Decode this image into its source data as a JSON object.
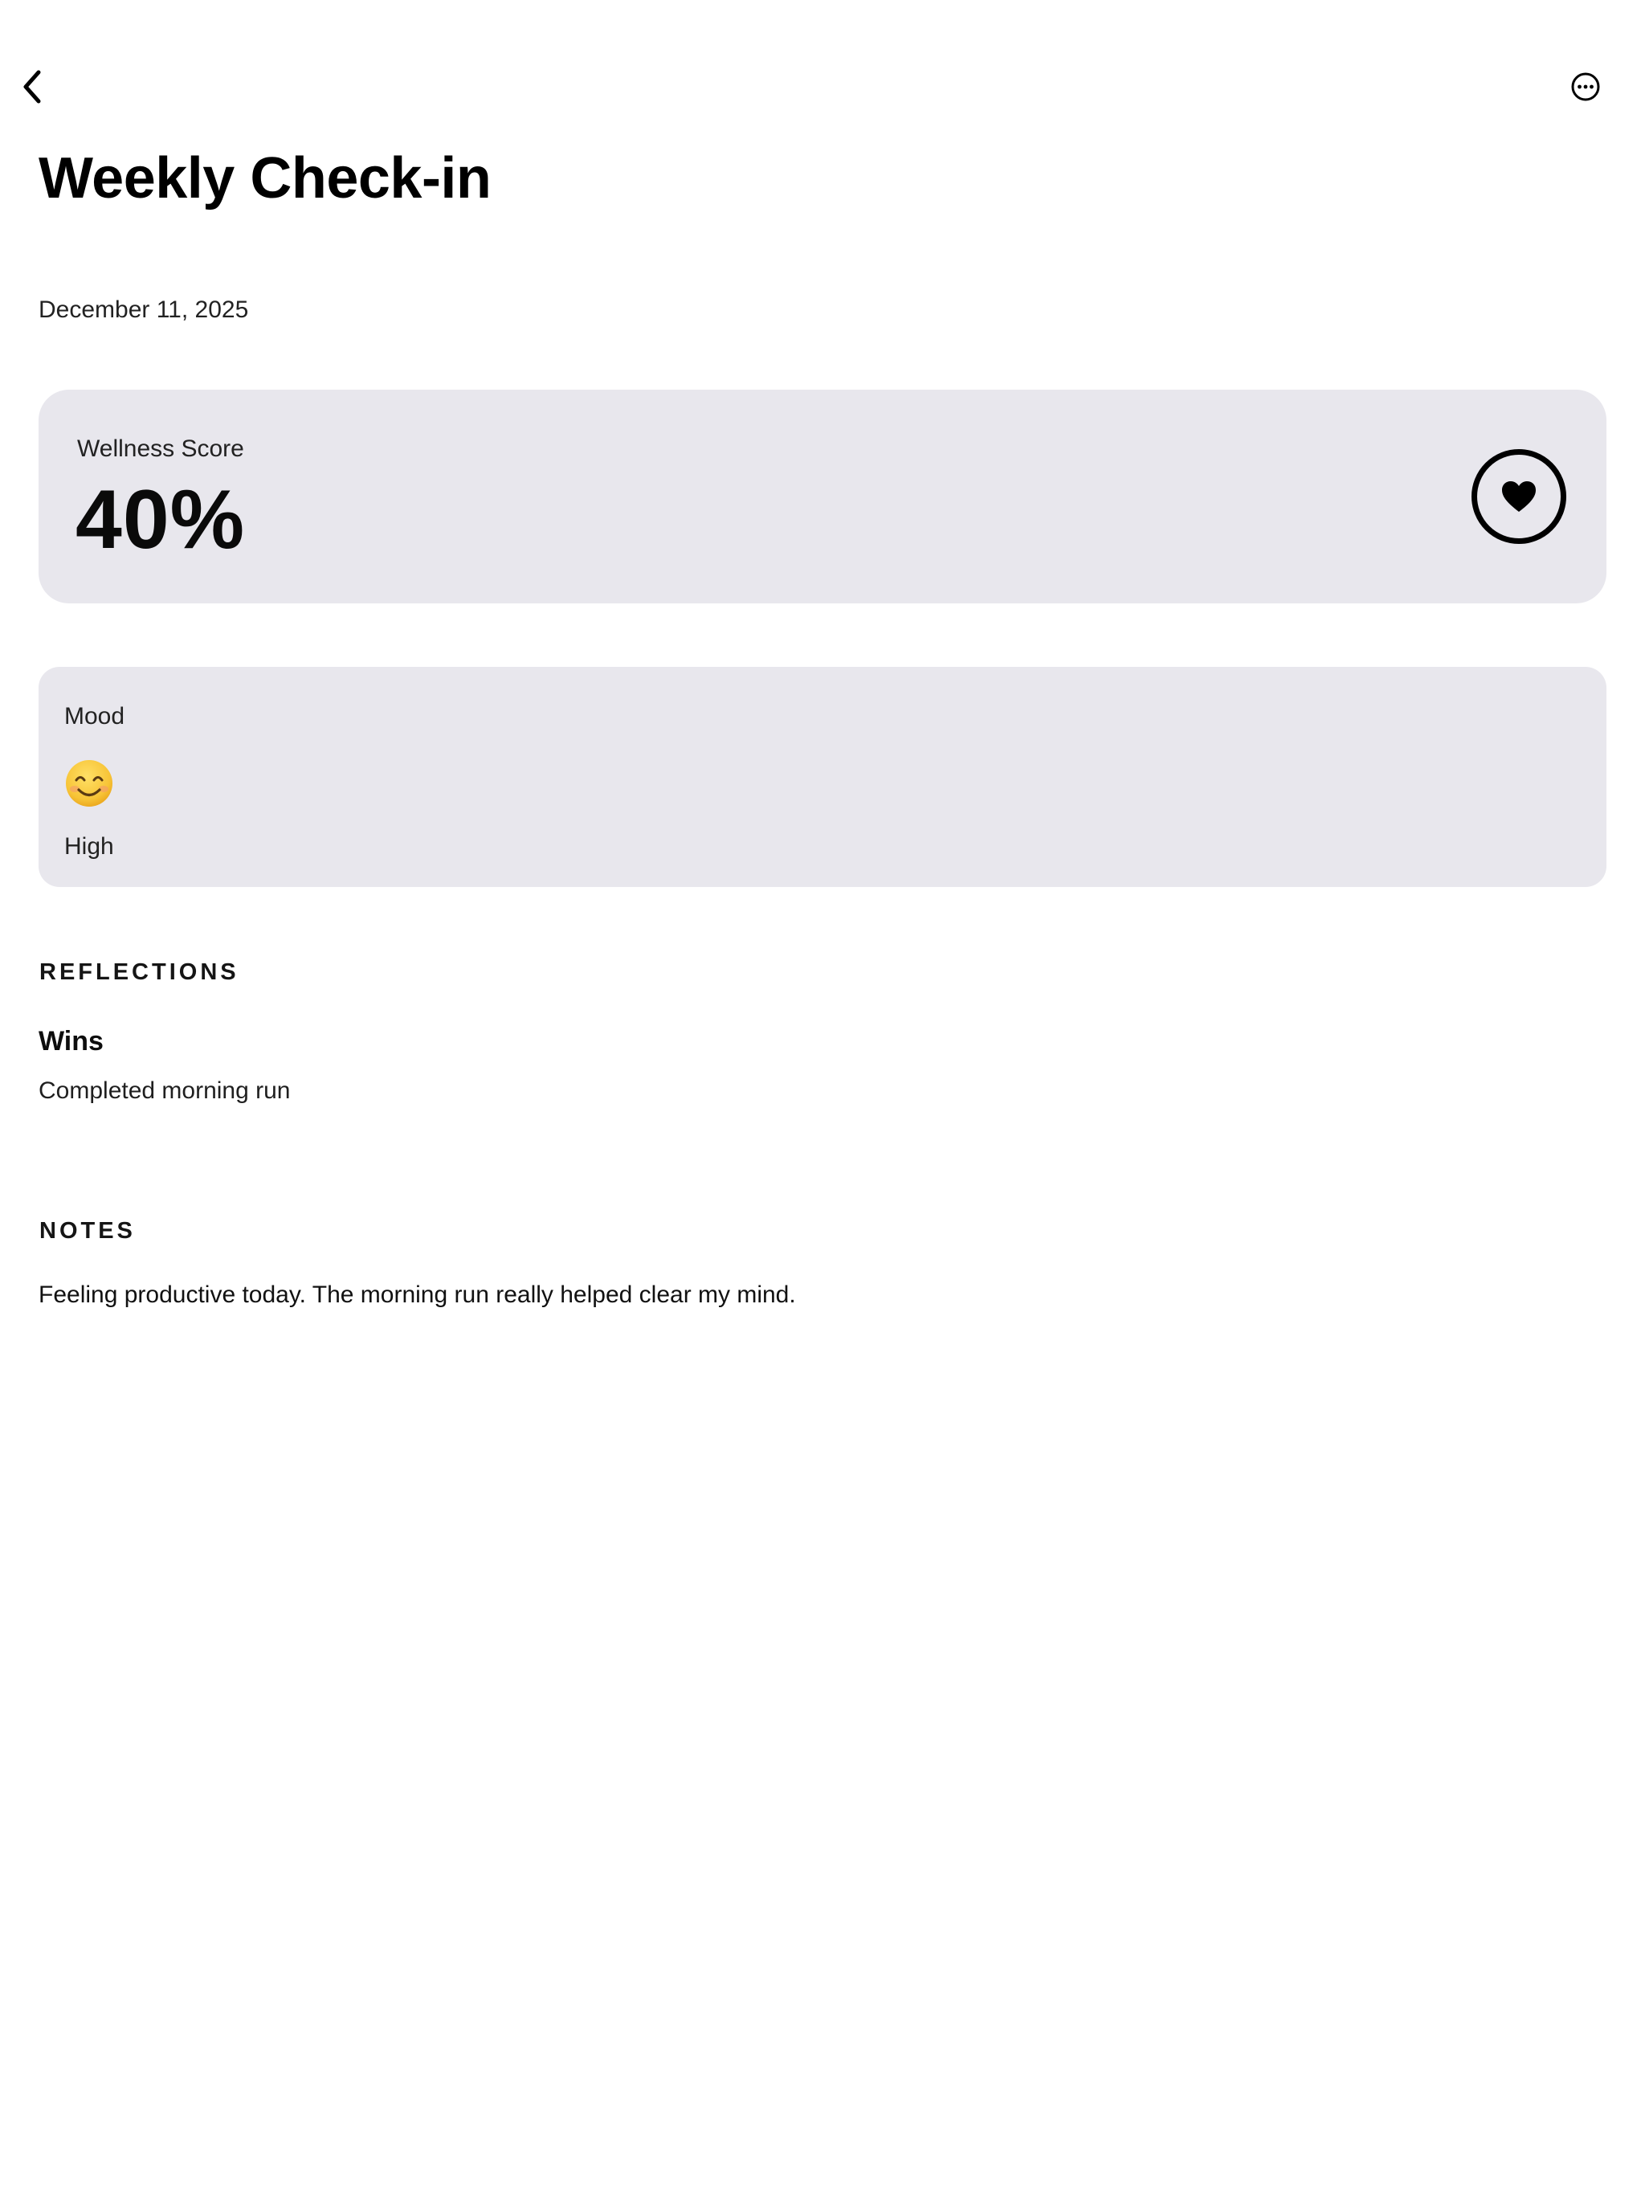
{
  "nav": {
    "back_icon": "chevron-left-icon",
    "more_icon": "ellipsis-circle-icon"
  },
  "header": {
    "title": "Weekly Check-in",
    "date": "December 11, 2025"
  },
  "wellness": {
    "label": "Wellness Score",
    "value": "40%",
    "icon": "heart-icon"
  },
  "mood": {
    "label": "Mood",
    "icon": "smiling-face-icon",
    "value": "High"
  },
  "reflections": {
    "heading": "REFLECTIONS",
    "wins_title": "Wins",
    "wins_text": "Completed morning run"
  },
  "notes": {
    "heading": "NOTES",
    "text": "Feeling productive today. The morning run really helped clear my mind."
  },
  "colors": {
    "card_background": "#e8e7ed",
    "text_primary": "#000000",
    "emoji_yellow": "#f7c437"
  }
}
